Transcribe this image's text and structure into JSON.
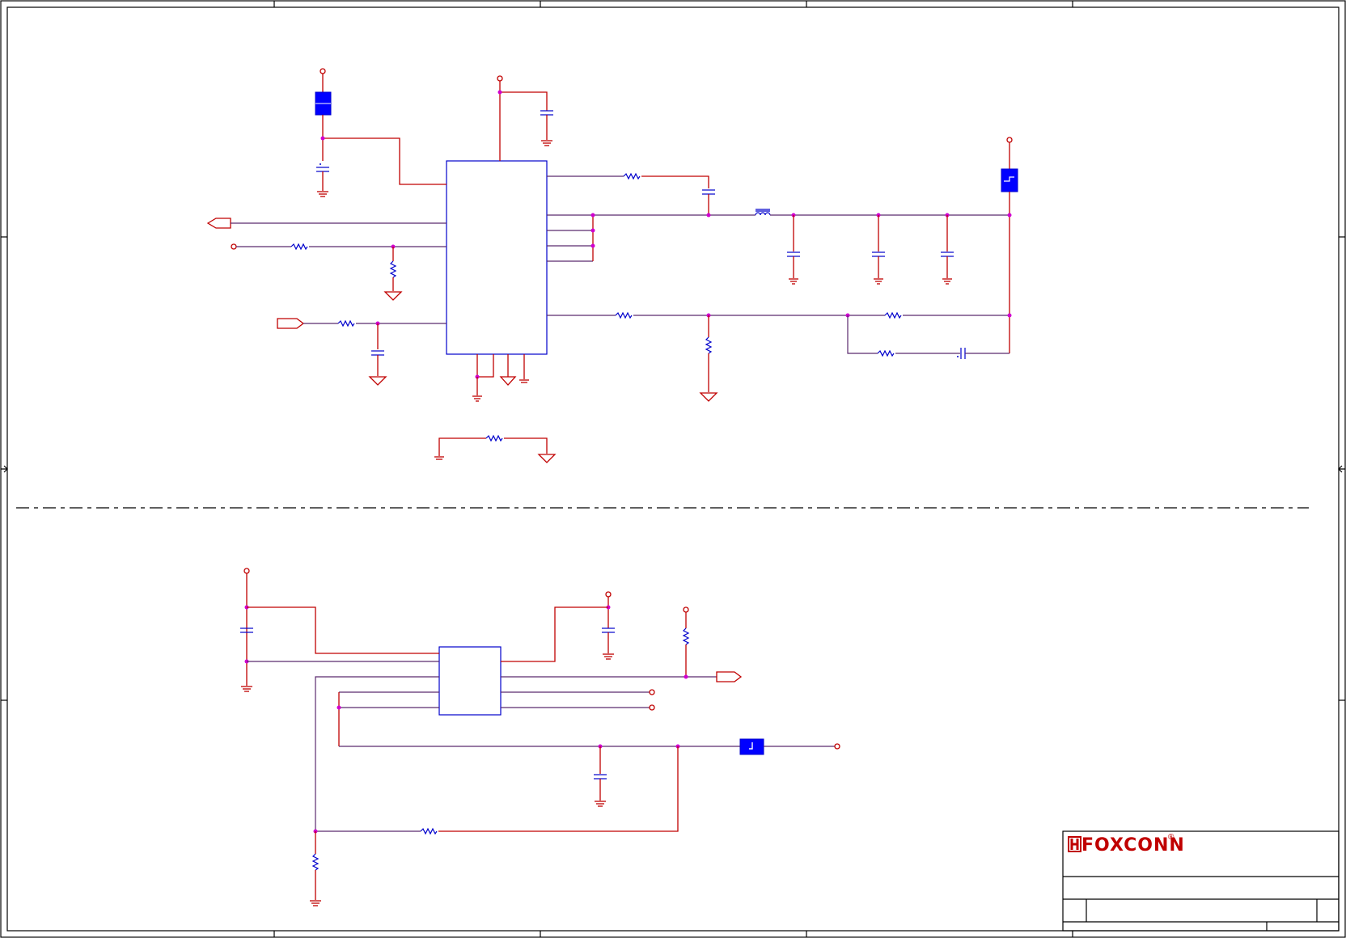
{
  "title_block": {
    "company_logo": "FOXCONN",
    "registered_mark": "®",
    "logo_icon": "foxconn-h-logo-icon"
  },
  "colors": {
    "wire": "#c00000",
    "component": "#0000cc",
    "junction": "#d000d0",
    "fill": "#0000ff",
    "frame": "#000000"
  }
}
